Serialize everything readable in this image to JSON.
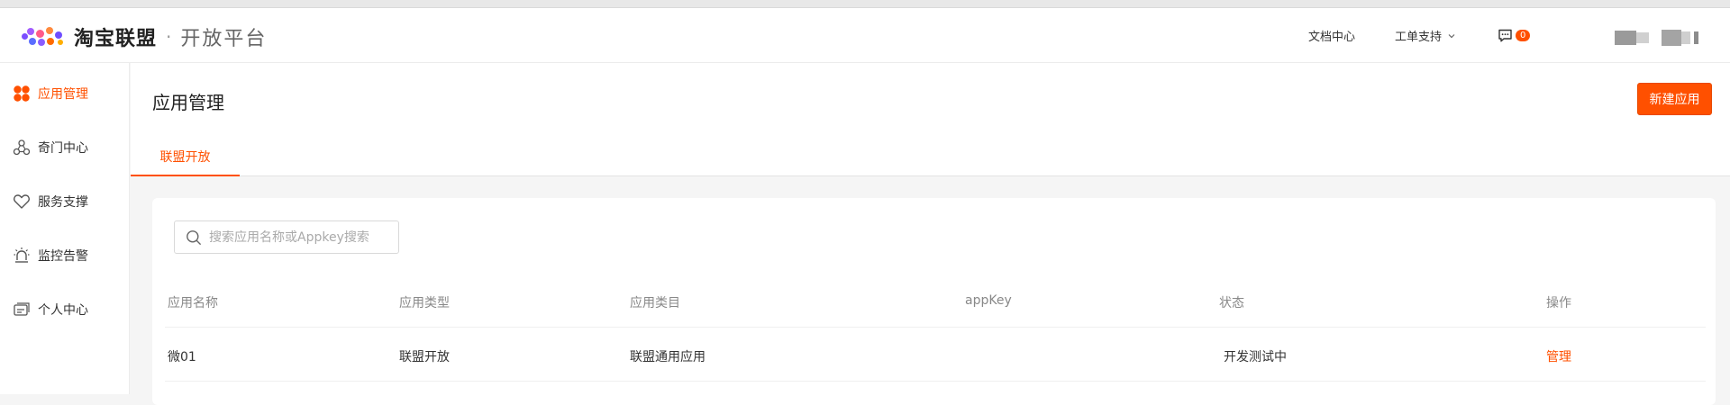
{
  "header": {
    "brand": "淘宝联盟",
    "separator": "·",
    "platform": "开放平台",
    "nav": {
      "docs": "文档中心",
      "ticket_support": "工单支持",
      "message_count": "0"
    }
  },
  "sidebar": {
    "items": [
      {
        "label": "应用管理",
        "icon": "app-grid-icon",
        "active": true
      },
      {
        "label": "奇门中心",
        "icon": "qimen-nodes-icon"
      },
      {
        "label": "服务支撑",
        "icon": "heart-icon"
      },
      {
        "label": "监控告警",
        "icon": "alarm-light-icon"
      },
      {
        "label": "个人中心",
        "icon": "user-card-icon"
      }
    ]
  },
  "main": {
    "title": "应用管理",
    "new_button": "新建应用",
    "tabs": [
      {
        "label": "联盟开放"
      }
    ],
    "search": {
      "placeholder": "搜索应用名称或Appkey搜索"
    },
    "table": {
      "columns": [
        "应用名称",
        "应用类型",
        "应用类目",
        "appKey",
        "状态",
        "操作"
      ],
      "rows": [
        {
          "name": "微01",
          "type": "联盟开放",
          "category": "联盟通用应用",
          "appkey": "",
          "status": "开发测试中",
          "action": "管理"
        }
      ]
    }
  },
  "colors": {
    "accent": "#ff5000",
    "text": "#333333",
    "muted": "#888888"
  }
}
